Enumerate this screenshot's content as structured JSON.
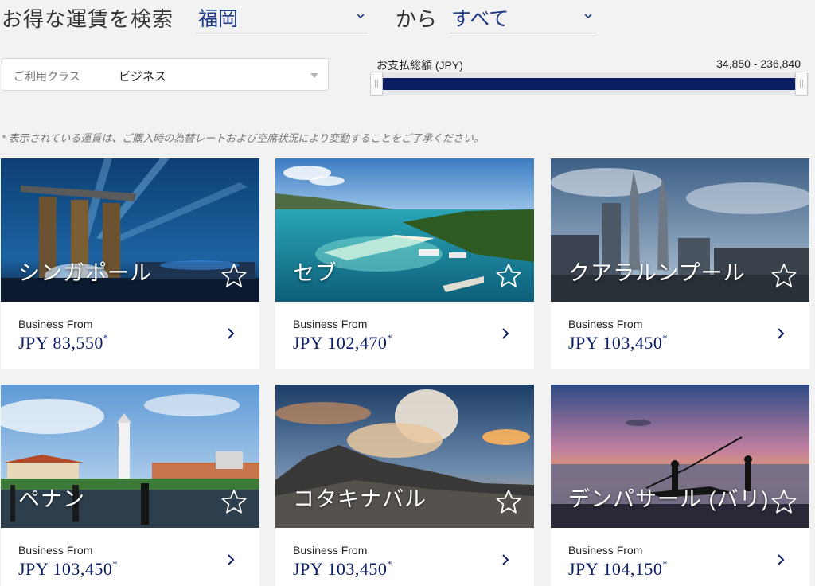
{
  "header": {
    "title": "お得な運賃を検索",
    "origin": "福岡",
    "from_label": "から",
    "destination": "すべて"
  },
  "filters": {
    "class_label": "ご利用クラス",
    "class_value": "ビジネス",
    "price_label": "お支払総額 (JPY)",
    "price_range": "34,850 - 236,840"
  },
  "note": "* 表示されている運賃は、ご購入時の為替レートおよび空席状況により変動することをご了承ください。",
  "cards": [
    {
      "city": "シンガポール",
      "class_from": "Business From",
      "price": "JPY 83,550",
      "mark": "*"
    },
    {
      "city": "セブ",
      "class_from": "Business From",
      "price": "JPY 102,470",
      "mark": "*"
    },
    {
      "city": "クアラルンプール",
      "class_from": "Business From",
      "price": "JPY 103,450",
      "mark": "*"
    },
    {
      "city": "ペナン",
      "class_from": "Business From",
      "price": "JPY 103,450",
      "mark": "*"
    },
    {
      "city": "コタキナバル",
      "class_from": "Business From",
      "price": "JPY 103,450",
      "mark": "*"
    },
    {
      "city": "デンパサール (バリ)",
      "class_from": "Business From",
      "price": "JPY 104,150",
      "mark": "*"
    }
  ],
  "colors": {
    "accent": "#0b1e64",
    "link_blue": "#1c3a85"
  },
  "icons": {
    "favorite": "star-outline-icon",
    "next": "chevron-right-icon",
    "dropdown": "chevron-down-icon"
  }
}
